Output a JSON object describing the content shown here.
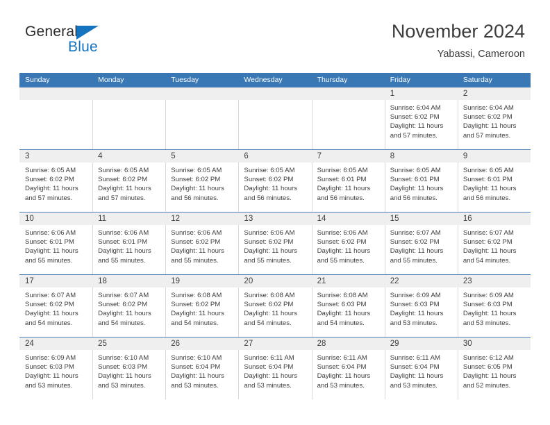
{
  "brand": {
    "name_part1": "General",
    "name_part2": "Blue",
    "accent_color": "#1673bd"
  },
  "header": {
    "title": "November 2024",
    "location": "Yabassi, Cameroon"
  },
  "theme": {
    "header_blue": "#3a78b5",
    "daynum_band": "#efefef",
    "text": "#3c3c3c"
  },
  "weekday_headers": [
    "Sunday",
    "Monday",
    "Tuesday",
    "Wednesday",
    "Thursday",
    "Friday",
    "Saturday"
  ],
  "weeks": [
    [
      {
        "day": "",
        "sunrise": "",
        "sunset": "",
        "daylight1": "",
        "daylight2": ""
      },
      {
        "day": "",
        "sunrise": "",
        "sunset": "",
        "daylight1": "",
        "daylight2": ""
      },
      {
        "day": "",
        "sunrise": "",
        "sunset": "",
        "daylight1": "",
        "daylight2": ""
      },
      {
        "day": "",
        "sunrise": "",
        "sunset": "",
        "daylight1": "",
        "daylight2": ""
      },
      {
        "day": "",
        "sunrise": "",
        "sunset": "",
        "daylight1": "",
        "daylight2": ""
      },
      {
        "day": "1",
        "sunrise": "Sunrise: 6:04 AM",
        "sunset": "Sunset: 6:02 PM",
        "daylight1": "Daylight: 11 hours",
        "daylight2": "and 57 minutes."
      },
      {
        "day": "2",
        "sunrise": "Sunrise: 6:04 AM",
        "sunset": "Sunset: 6:02 PM",
        "daylight1": "Daylight: 11 hours",
        "daylight2": "and 57 minutes."
      }
    ],
    [
      {
        "day": "3",
        "sunrise": "Sunrise: 6:05 AM",
        "sunset": "Sunset: 6:02 PM",
        "daylight1": "Daylight: 11 hours",
        "daylight2": "and 57 minutes."
      },
      {
        "day": "4",
        "sunrise": "Sunrise: 6:05 AM",
        "sunset": "Sunset: 6:02 PM",
        "daylight1": "Daylight: 11 hours",
        "daylight2": "and 57 minutes."
      },
      {
        "day": "5",
        "sunrise": "Sunrise: 6:05 AM",
        "sunset": "Sunset: 6:02 PM",
        "daylight1": "Daylight: 11 hours",
        "daylight2": "and 56 minutes."
      },
      {
        "day": "6",
        "sunrise": "Sunrise: 6:05 AM",
        "sunset": "Sunset: 6:02 PM",
        "daylight1": "Daylight: 11 hours",
        "daylight2": "and 56 minutes."
      },
      {
        "day": "7",
        "sunrise": "Sunrise: 6:05 AM",
        "sunset": "Sunset: 6:01 PM",
        "daylight1": "Daylight: 11 hours",
        "daylight2": "and 56 minutes."
      },
      {
        "day": "8",
        "sunrise": "Sunrise: 6:05 AM",
        "sunset": "Sunset: 6:01 PM",
        "daylight1": "Daylight: 11 hours",
        "daylight2": "and 56 minutes."
      },
      {
        "day": "9",
        "sunrise": "Sunrise: 6:05 AM",
        "sunset": "Sunset: 6:01 PM",
        "daylight1": "Daylight: 11 hours",
        "daylight2": "and 56 minutes."
      }
    ],
    [
      {
        "day": "10",
        "sunrise": "Sunrise: 6:06 AM",
        "sunset": "Sunset: 6:01 PM",
        "daylight1": "Daylight: 11 hours",
        "daylight2": "and 55 minutes."
      },
      {
        "day": "11",
        "sunrise": "Sunrise: 6:06 AM",
        "sunset": "Sunset: 6:01 PM",
        "daylight1": "Daylight: 11 hours",
        "daylight2": "and 55 minutes."
      },
      {
        "day": "12",
        "sunrise": "Sunrise: 6:06 AM",
        "sunset": "Sunset: 6:02 PM",
        "daylight1": "Daylight: 11 hours",
        "daylight2": "and 55 minutes."
      },
      {
        "day": "13",
        "sunrise": "Sunrise: 6:06 AM",
        "sunset": "Sunset: 6:02 PM",
        "daylight1": "Daylight: 11 hours",
        "daylight2": "and 55 minutes."
      },
      {
        "day": "14",
        "sunrise": "Sunrise: 6:06 AM",
        "sunset": "Sunset: 6:02 PM",
        "daylight1": "Daylight: 11 hours",
        "daylight2": "and 55 minutes."
      },
      {
        "day": "15",
        "sunrise": "Sunrise: 6:07 AM",
        "sunset": "Sunset: 6:02 PM",
        "daylight1": "Daylight: 11 hours",
        "daylight2": "and 55 minutes."
      },
      {
        "day": "16",
        "sunrise": "Sunrise: 6:07 AM",
        "sunset": "Sunset: 6:02 PM",
        "daylight1": "Daylight: 11 hours",
        "daylight2": "and 54 minutes."
      }
    ],
    [
      {
        "day": "17",
        "sunrise": "Sunrise: 6:07 AM",
        "sunset": "Sunset: 6:02 PM",
        "daylight1": "Daylight: 11 hours",
        "daylight2": "and 54 minutes."
      },
      {
        "day": "18",
        "sunrise": "Sunrise: 6:07 AM",
        "sunset": "Sunset: 6:02 PM",
        "daylight1": "Daylight: 11 hours",
        "daylight2": "and 54 minutes."
      },
      {
        "day": "19",
        "sunrise": "Sunrise: 6:08 AM",
        "sunset": "Sunset: 6:02 PM",
        "daylight1": "Daylight: 11 hours",
        "daylight2": "and 54 minutes."
      },
      {
        "day": "20",
        "sunrise": "Sunrise: 6:08 AM",
        "sunset": "Sunset: 6:02 PM",
        "daylight1": "Daylight: 11 hours",
        "daylight2": "and 54 minutes."
      },
      {
        "day": "21",
        "sunrise": "Sunrise: 6:08 AM",
        "sunset": "Sunset: 6:03 PM",
        "daylight1": "Daylight: 11 hours",
        "daylight2": "and 54 minutes."
      },
      {
        "day": "22",
        "sunrise": "Sunrise: 6:09 AM",
        "sunset": "Sunset: 6:03 PM",
        "daylight1": "Daylight: 11 hours",
        "daylight2": "and 53 minutes."
      },
      {
        "day": "23",
        "sunrise": "Sunrise: 6:09 AM",
        "sunset": "Sunset: 6:03 PM",
        "daylight1": "Daylight: 11 hours",
        "daylight2": "and 53 minutes."
      }
    ],
    [
      {
        "day": "24",
        "sunrise": "Sunrise: 6:09 AM",
        "sunset": "Sunset: 6:03 PM",
        "daylight1": "Daylight: 11 hours",
        "daylight2": "and 53 minutes."
      },
      {
        "day": "25",
        "sunrise": "Sunrise: 6:10 AM",
        "sunset": "Sunset: 6:03 PM",
        "daylight1": "Daylight: 11 hours",
        "daylight2": "and 53 minutes."
      },
      {
        "day": "26",
        "sunrise": "Sunrise: 6:10 AM",
        "sunset": "Sunset: 6:04 PM",
        "daylight1": "Daylight: 11 hours",
        "daylight2": "and 53 minutes."
      },
      {
        "day": "27",
        "sunrise": "Sunrise: 6:11 AM",
        "sunset": "Sunset: 6:04 PM",
        "daylight1": "Daylight: 11 hours",
        "daylight2": "and 53 minutes."
      },
      {
        "day": "28",
        "sunrise": "Sunrise: 6:11 AM",
        "sunset": "Sunset: 6:04 PM",
        "daylight1": "Daylight: 11 hours",
        "daylight2": "and 53 minutes."
      },
      {
        "day": "29",
        "sunrise": "Sunrise: 6:11 AM",
        "sunset": "Sunset: 6:04 PM",
        "daylight1": "Daylight: 11 hours",
        "daylight2": "and 53 minutes."
      },
      {
        "day": "30",
        "sunrise": "Sunrise: 6:12 AM",
        "sunset": "Sunset: 6:05 PM",
        "daylight1": "Daylight: 11 hours",
        "daylight2": "and 52 minutes."
      }
    ]
  ]
}
